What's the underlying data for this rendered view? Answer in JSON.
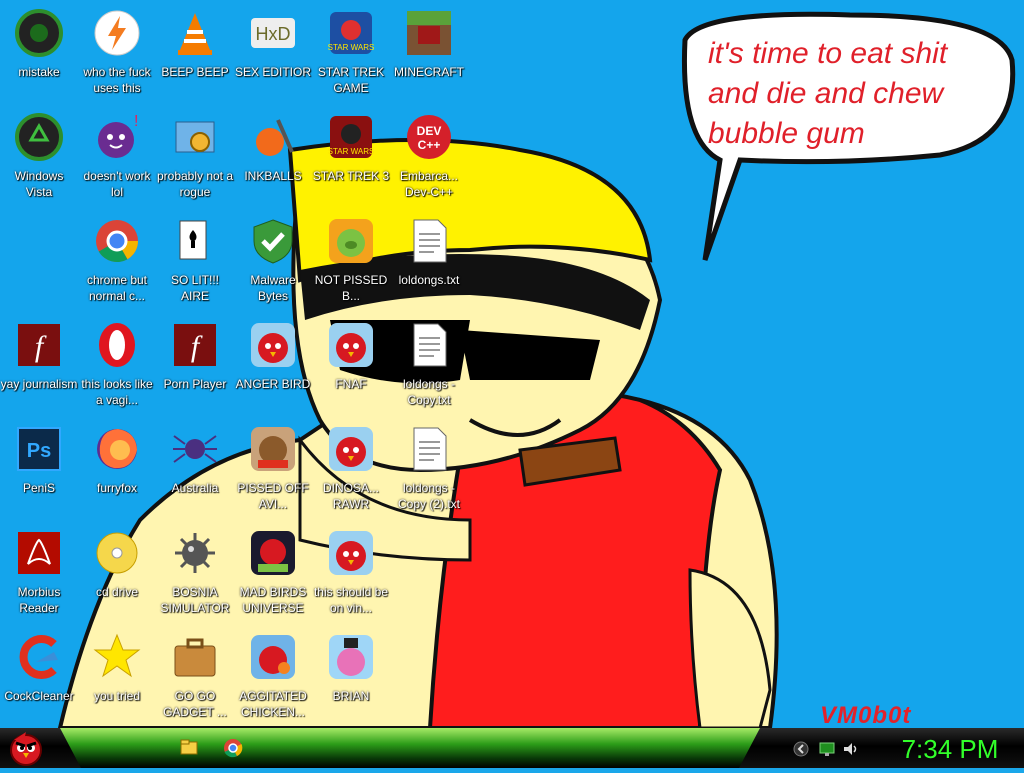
{
  "speech_bubble": "it's time to eat shit and die and chew bubble gum",
  "signature": "VM0b0t",
  "icons": [
    {
      "label": "mistake",
      "icon": "xbox-disc-icon"
    },
    {
      "label": "who the fuck uses this",
      "icon": "winamp-bolt-icon"
    },
    {
      "label": "BEEP BEEP",
      "icon": "vlc-cone-icon"
    },
    {
      "label": "SEX EDITIOR",
      "icon": "hxd-editor-icon"
    },
    {
      "label": "STAR TREK GAME",
      "icon": "star-wars-game-icon"
    },
    {
      "label": "MINECRAFT",
      "icon": "minecraft-icon"
    },
    {
      "label": "Windows Vista",
      "icon": "recycle-disc-icon"
    },
    {
      "label": "doesn't work lol",
      "icon": "yahoo-messenger-icon"
    },
    {
      "label": "probably not a rogue",
      "icon": "gear-program-icon"
    },
    {
      "label": "INKBALLS",
      "icon": "inkball-icon"
    },
    {
      "label": "STAR TREK 3",
      "icon": "star-wars-3-icon"
    },
    {
      "label": "Embarca... Dev-C++",
      "icon": "devcpp-icon"
    },
    {
      "label": "chrome but normal c...",
      "icon": "chrome-icon"
    },
    {
      "label": "SO LIT!!! AIRE",
      "icon": "solitaire-icon"
    },
    {
      "label": "Malware Bytes",
      "icon": "shield-check-icon"
    },
    {
      "label": "NOT PISSED B...",
      "icon": "bad-piggies-icon"
    },
    {
      "label": "loldongs.txt",
      "icon": "text-file-icon"
    },
    {
      "label": "yay journalism",
      "icon": "flash-icon"
    },
    {
      "label": "this looks like a vagi...",
      "icon": "opera-icon"
    },
    {
      "label": "Porn Player",
      "icon": "flash-player-icon"
    },
    {
      "label": "ANGER BIRD",
      "icon": "angry-birds-icon"
    },
    {
      "label": "FNAF",
      "icon": "angry-birds-icon"
    },
    {
      "label": "loldongs - Copy.txt",
      "icon": "text-file-icon"
    },
    {
      "label": "PeniS",
      "icon": "photoshop-icon"
    },
    {
      "label": "furryfox",
      "icon": "firefox-icon"
    },
    {
      "label": "Australia",
      "icon": "spider-solitaire-icon"
    },
    {
      "label": "PISSED OFF AVI...",
      "icon": "angry-birds-seasons-icon"
    },
    {
      "label": "DINOSA... RAWR",
      "icon": "angry-birds-icon"
    },
    {
      "label": "loldongs - Copy (2).txt",
      "icon": "text-file-icon"
    },
    {
      "label": "Morbius Reader",
      "icon": "acrobat-reader-icon"
    },
    {
      "label": "cd drive",
      "icon": "cd-drive-icon"
    },
    {
      "label": "BOSNIA SIMULATOR",
      "icon": "mine-icon"
    },
    {
      "label": "MAD BIRDS UNIVERSE",
      "icon": "angry-birds-space-icon"
    },
    {
      "label": "this should be on vin...",
      "icon": "angry-birds-icon"
    },
    {
      "label": "CockCleaner",
      "icon": "ccleaner-icon"
    },
    {
      "label": "you tried",
      "icon": "star-icon"
    },
    {
      "label": "GO GO GADGET ...",
      "icon": "briefcase-icon"
    },
    {
      "label": "AGGITATED CHICKEN...",
      "icon": "angry-birds-rio-icon"
    },
    {
      "label": "BRIAN",
      "icon": "angry-birds-stella-icon"
    }
  ],
  "taskbar": {
    "start_icon": "angry-bird-start-icon",
    "pinned": [
      "file-explorer-icon",
      "chrome-icon"
    ],
    "tray": [
      "back-arrow-icon",
      "monitor-icon",
      "speaker-icon"
    ],
    "clock": "7:34 PM"
  }
}
